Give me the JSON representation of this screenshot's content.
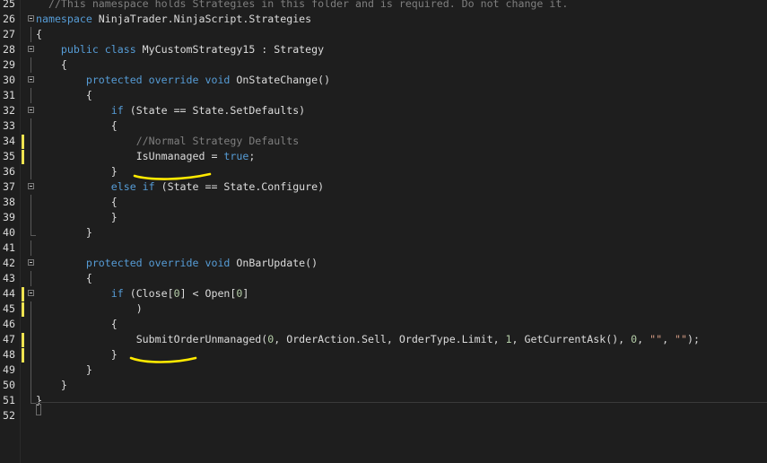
{
  "lines": [
    {
      "num": "25",
      "tokens": [
        {
          "c": "gray-cm",
          "t": "//This namespace holds Strategies in this folder and is required. Do not change it."
        }
      ],
      "indent": "  "
    },
    {
      "num": "26",
      "tokens": [
        {
          "c": "kw",
          "t": "namespace"
        },
        {
          "c": "tx",
          "t": " NinjaTrader.NinjaScript.Strategies"
        }
      ],
      "indent": ""
    },
    {
      "num": "27",
      "tokens": [
        {
          "c": "tx",
          "t": "{"
        }
      ],
      "indent": ""
    },
    {
      "num": "28",
      "tokens": [
        {
          "c": "kw",
          "t": "public"
        },
        {
          "c": "tx",
          "t": " "
        },
        {
          "c": "kw",
          "t": "class"
        },
        {
          "c": "tx",
          "t": " MyCustomStrategy15 : Strategy"
        }
      ],
      "indent": "    "
    },
    {
      "num": "29",
      "tokens": [
        {
          "c": "tx",
          "t": "{"
        }
      ],
      "indent": "    "
    },
    {
      "num": "30",
      "tokens": [
        {
          "c": "kw",
          "t": "protected"
        },
        {
          "c": "tx",
          "t": " "
        },
        {
          "c": "kw",
          "t": "override"
        },
        {
          "c": "tx",
          "t": " "
        },
        {
          "c": "kw",
          "t": "void"
        },
        {
          "c": "tx",
          "t": " OnStateChange()"
        }
      ],
      "indent": "        "
    },
    {
      "num": "31",
      "tokens": [
        {
          "c": "tx",
          "t": "{"
        }
      ],
      "indent": "        "
    },
    {
      "num": "32",
      "tokens": [
        {
          "c": "kw",
          "t": "if"
        },
        {
          "c": "tx",
          "t": " (State == State.SetDefaults)"
        }
      ],
      "indent": "            "
    },
    {
      "num": "33",
      "tokens": [
        {
          "c": "tx",
          "t": "{"
        }
      ],
      "indent": "            "
    },
    {
      "num": "34",
      "tokens": [
        {
          "c": "gray-cm",
          "t": "//Normal Strategy Defaults"
        }
      ],
      "indent": "                "
    },
    {
      "num": "35",
      "tokens": [
        {
          "c": "tx",
          "t": "IsUnmanaged = "
        },
        {
          "c": "kw",
          "t": "true"
        },
        {
          "c": "tx",
          "t": ";"
        }
      ],
      "indent": "                "
    },
    {
      "num": "36",
      "tokens": [
        {
          "c": "tx",
          "t": "}"
        }
      ],
      "indent": "            "
    },
    {
      "num": "37",
      "tokens": [
        {
          "c": "kw",
          "t": "else"
        },
        {
          "c": "tx",
          "t": " "
        },
        {
          "c": "kw",
          "t": "if"
        },
        {
          "c": "tx",
          "t": " (State == State.Configure)"
        }
      ],
      "indent": "            "
    },
    {
      "num": "38",
      "tokens": [
        {
          "c": "tx",
          "t": "{"
        }
      ],
      "indent": "            "
    },
    {
      "num": "39",
      "tokens": [
        {
          "c": "tx",
          "t": "}"
        }
      ],
      "indent": "            "
    },
    {
      "num": "40",
      "tokens": [
        {
          "c": "tx",
          "t": "}"
        }
      ],
      "indent": "        "
    },
    {
      "num": "41",
      "tokens": [],
      "indent": ""
    },
    {
      "num": "42",
      "tokens": [
        {
          "c": "kw",
          "t": "protected"
        },
        {
          "c": "tx",
          "t": " "
        },
        {
          "c": "kw",
          "t": "override"
        },
        {
          "c": "tx",
          "t": " "
        },
        {
          "c": "kw",
          "t": "void"
        },
        {
          "c": "tx",
          "t": " OnBarUpdate()"
        }
      ],
      "indent": "        "
    },
    {
      "num": "43",
      "tokens": [
        {
          "c": "tx",
          "t": "{"
        }
      ],
      "indent": "        "
    },
    {
      "num": "44",
      "tokens": [
        {
          "c": "kw",
          "t": "if"
        },
        {
          "c": "tx",
          "t": " (Close["
        },
        {
          "c": "nm",
          "t": "0"
        },
        {
          "c": "tx",
          "t": "] < Open["
        },
        {
          "c": "nm",
          "t": "0"
        },
        {
          "c": "tx",
          "t": "]"
        }
      ],
      "indent": "            "
    },
    {
      "num": "45",
      "tokens": [
        {
          "c": "tx",
          "t": ")"
        }
      ],
      "indent": "                "
    },
    {
      "num": "46",
      "tokens": [
        {
          "c": "tx",
          "t": "{"
        }
      ],
      "indent": "            "
    },
    {
      "num": "47",
      "tokens": [
        {
          "c": "tx",
          "t": "SubmitOrderUnmanaged("
        },
        {
          "c": "nm",
          "t": "0"
        },
        {
          "c": "tx",
          "t": ", OrderAction.Sell, OrderType.Limit, "
        },
        {
          "c": "nm",
          "t": "1"
        },
        {
          "c": "tx",
          "t": ", GetCurrentAsk(), "
        },
        {
          "c": "nm",
          "t": "0"
        },
        {
          "c": "tx",
          "t": ", "
        },
        {
          "c": "st",
          "t": "\"\""
        },
        {
          "c": "tx",
          "t": ", "
        },
        {
          "c": "st",
          "t": "\"\""
        },
        {
          "c": "tx",
          "t": ");"
        }
      ],
      "indent": "                "
    },
    {
      "num": "48",
      "tokens": [
        {
          "c": "tx",
          "t": "}"
        }
      ],
      "indent": "            "
    },
    {
      "num": "49",
      "tokens": [
        {
          "c": "tx",
          "t": "}"
        }
      ],
      "indent": "        "
    },
    {
      "num": "50",
      "tokens": [
        {
          "c": "tx",
          "t": "}"
        }
      ],
      "indent": "    "
    },
    {
      "num": "51",
      "tokens": [
        {
          "c": "tx",
          "t": "}"
        }
      ],
      "indent": ""
    },
    {
      "num": "52",
      "tokens": [],
      "indent": ""
    }
  ],
  "colors": {
    "background": "#1e1e1e",
    "keyword": "#569cd6",
    "comment": "#7f7f7f",
    "number": "#b5cea8",
    "string": "#d69d85",
    "text": "#dcdcdc",
    "change_marker": "#efe350",
    "annotation_underline": "#ffea00"
  }
}
